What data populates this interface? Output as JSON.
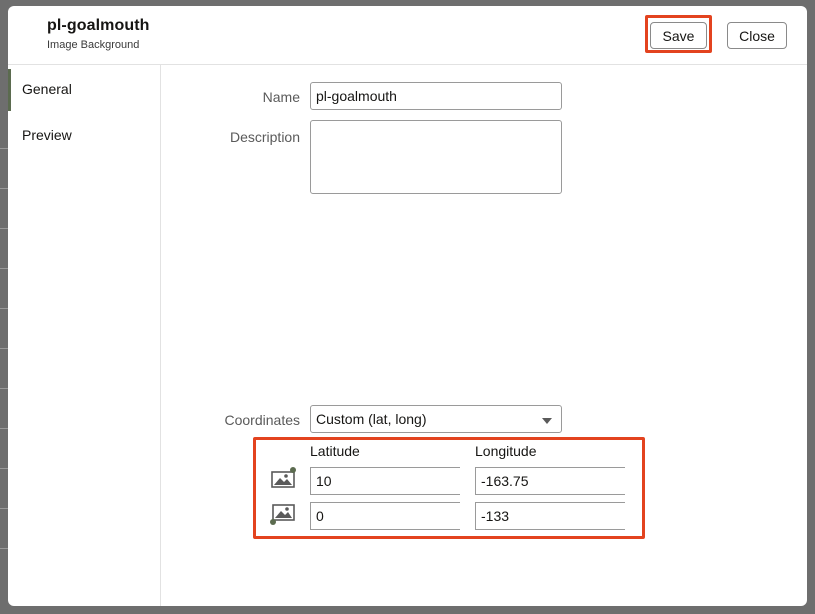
{
  "dialog": {
    "title": "pl-goalmouth",
    "subtitle": "Image Background",
    "save_label": "Save",
    "close_label": "Close"
  },
  "sidebar": {
    "items": [
      {
        "label": "General",
        "active": true
      },
      {
        "label": "Preview",
        "active": false
      }
    ]
  },
  "form": {
    "name_label": "Name",
    "name_value": "pl-goalmouth",
    "description_label": "Description",
    "description_value": "",
    "coordinates_label": "Coordinates",
    "coordinates_value": "Custom (lat, long)",
    "latitude_header": "Latitude",
    "longitude_header": "Longitude",
    "rows": [
      {
        "icon": "image-top-right-anchor-icon",
        "latitude": "10",
        "longitude": "-163.75"
      },
      {
        "icon": "image-bottom-left-anchor-icon",
        "latitude": "0",
        "longitude": "-133"
      }
    ]
  },
  "colors": {
    "highlight": "#e3431f",
    "accent": "#5b6b4f",
    "backdrop": "#6e6e6e"
  }
}
